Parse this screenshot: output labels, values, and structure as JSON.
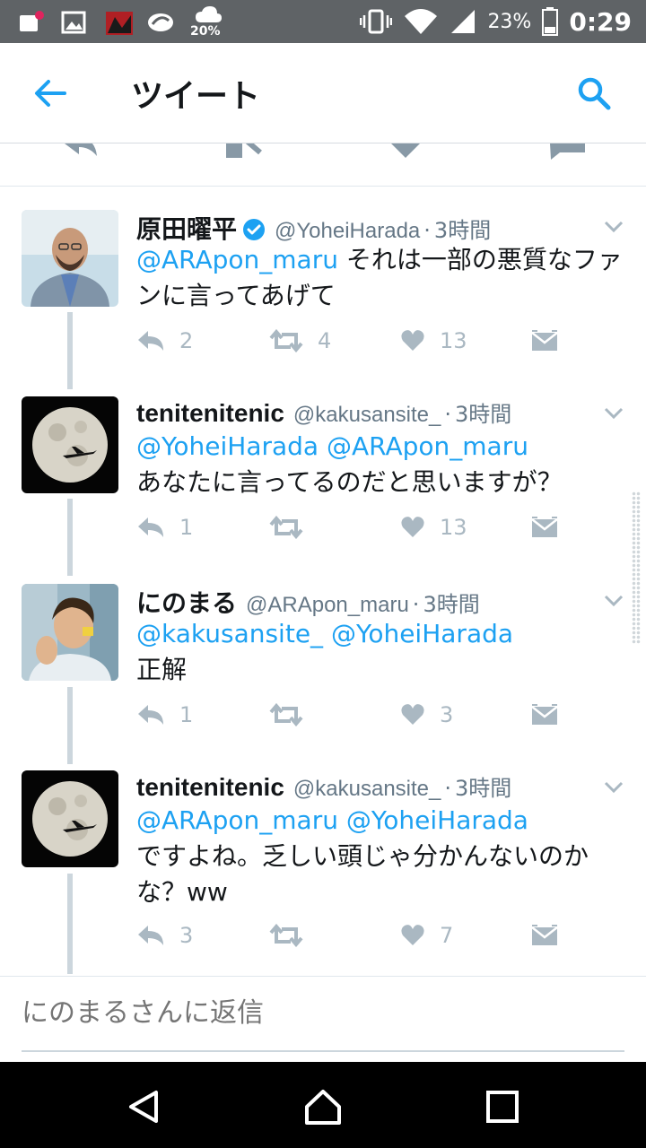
{
  "status_bar": {
    "weather_percent": "20%",
    "battery_percent": "23%",
    "time": "0:29",
    "icons": [
      "notification-icon",
      "image-icon",
      "app-icon",
      "app-icon-2",
      "weather-icon",
      "vibrate-icon",
      "wifi-icon",
      "signal-icon",
      "battery-icon"
    ]
  },
  "appbar": {
    "title": "ツイート",
    "back_icon": "arrow-left-icon",
    "search_icon": "search-icon",
    "accent_color": "#1da1f2"
  },
  "tweets": [
    {
      "name": "原田曜平",
      "verified": true,
      "handle": "@YoheiHarada",
      "time": "3時間",
      "mentions": "@ARApon_maru",
      "text": " それは一部の悪質なファンに言ってあげて",
      "replies": "2",
      "retweets": "4",
      "likes": "13"
    },
    {
      "name": "tenitenitenic",
      "verified": false,
      "handle": "@kakusansite_",
      "time": "3時間",
      "mentions": "@YoheiHarada @ARApon_maru",
      "text": "あなたに言ってるのだと思いますが？",
      "replies": "1",
      "retweets": "",
      "likes": "13"
    },
    {
      "name": "にのまる",
      "verified": false,
      "handle": "@ARApon_maru",
      "time": "3時間",
      "mentions": "@kakusansite_ @YoheiHarada",
      "text": "正解",
      "replies": "1",
      "retweets": "",
      "likes": "3"
    },
    {
      "name": "tenitenitenic",
      "verified": false,
      "handle": "@kakusansite_",
      "time": "3時間",
      "mentions": "@ARApon_maru @YoheiHarada",
      "text": "ですよね。乏しい頭じゃ分かんないのかな？ww",
      "replies": "3",
      "retweets": "",
      "likes": "7"
    }
  ],
  "reply_box": {
    "placeholder": "にのまるさんに返信"
  },
  "navbar": {
    "icons": [
      "back-triangle-icon",
      "home-icon",
      "recents-square-icon"
    ]
  }
}
